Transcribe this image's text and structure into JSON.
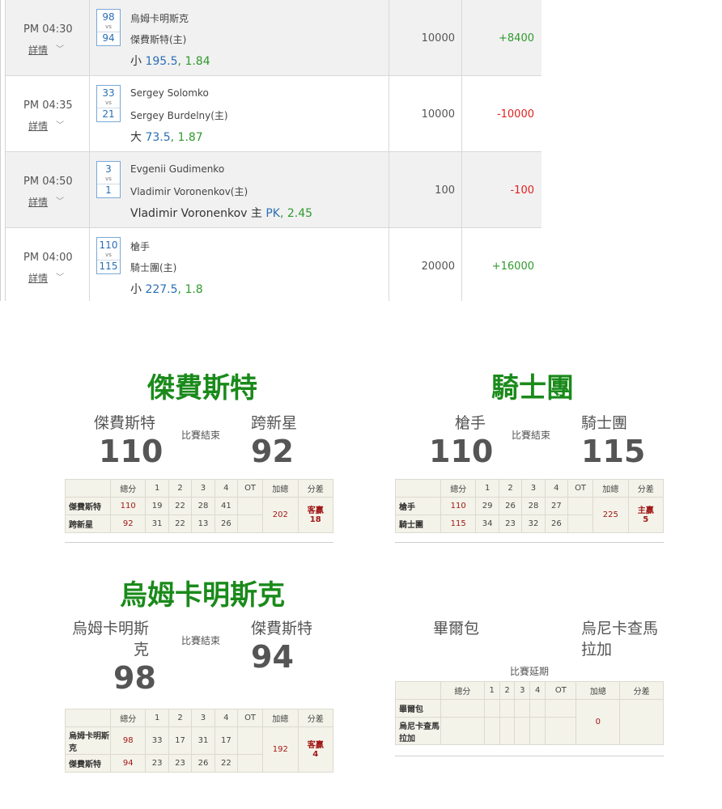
{
  "bets": [
    {
      "time": "PM 04:30",
      "detail": "詳情",
      "score1": "98",
      "score2": "94",
      "vs": "vs",
      "team1": "烏姆卡明斯克",
      "team2": "傑費斯特(主)",
      "pick_prefix": "小 ",
      "pick_line": "195.5",
      "pick_sep": ", ",
      "pick_odds": "1.84",
      "stake": "10000",
      "result": "+8400",
      "result_sign": "pos"
    },
    {
      "time": "PM 04:35",
      "detail": "詳情",
      "score1": "33",
      "score2": "21",
      "vs": "vs",
      "team1": "Sergey Solomko",
      "team2": "Sergey Burdelny(主)",
      "pick_prefix": "大 ",
      "pick_line": "73.5",
      "pick_sep": ", ",
      "pick_odds": "1.87",
      "stake": "10000",
      "result": "-10000",
      "result_sign": "neg"
    },
    {
      "time": "PM 04:50",
      "detail": "詳情",
      "score1": "3",
      "score2": "1",
      "vs": "vs",
      "team1": "Evgenii Gudimenko",
      "team2": "Vladimir Voronenkov(主)",
      "pick_prefix": "Vladimir Voronenkov 主 ",
      "pick_line": "PK",
      "pick_sep": ", ",
      "pick_odds": "2.45",
      "stake": "100",
      "result": "-100",
      "result_sign": "neg"
    },
    {
      "time": "PM 04:00",
      "detail": "詳情",
      "score1": "110",
      "score2": "115",
      "vs": "vs",
      "team1": "槍手",
      "team2": "騎士團(主)",
      "pick_prefix": "小 ",
      "pick_line": "227.5",
      "pick_sep": ", ",
      "pick_odds": "1.8",
      "stake": "20000",
      "result": "+16000",
      "result_sign": "pos"
    }
  ],
  "header_cols": [
    "總分",
    "1",
    "2",
    "3",
    "4",
    "OT",
    "加總",
    "分差"
  ],
  "cards": [
    {
      "winner": "傑費斯特",
      "home_name": "傑費斯特",
      "away_name": "跨新星",
      "status": "比賽結束",
      "home_score": "110",
      "away_score": "92",
      "rows": [
        {
          "name": "傑費斯特",
          "total": "110",
          "q": [
            "19",
            "22",
            "28",
            "41"
          ],
          "ot": ""
        },
        {
          "name": "跨新星",
          "total": "92",
          "q": [
            "31",
            "22",
            "13",
            "26"
          ],
          "ot": ""
        }
      ],
      "sum": "202",
      "diff1": "客贏",
      "diff2": "18"
    },
    {
      "winner": "騎士團",
      "home_name": "槍手",
      "away_name": "騎士團",
      "status": "比賽結束",
      "home_score": "110",
      "away_score": "115",
      "rows": [
        {
          "name": "槍手",
          "total": "110",
          "q": [
            "29",
            "26",
            "28",
            "27"
          ],
          "ot": ""
        },
        {
          "name": "騎士團",
          "total": "115",
          "q": [
            "34",
            "23",
            "32",
            "26"
          ],
          "ot": ""
        }
      ],
      "sum": "225",
      "diff1": "主贏",
      "diff2": "5"
    },
    {
      "winner": "烏姆卡明斯克",
      "home_name": "烏姆卡明斯克",
      "away_name": "傑費斯特",
      "status": "比賽結束",
      "home_score": "98",
      "away_score": "94",
      "rows": [
        {
          "name": "烏姆卡明斯克",
          "total": "98",
          "q": [
            "33",
            "17",
            "31",
            "17"
          ],
          "ot": ""
        },
        {
          "name": "傑費斯特",
          "total": "94",
          "q": [
            "23",
            "23",
            "26",
            "22"
          ],
          "ot": ""
        }
      ],
      "sum": "192",
      "diff1": "客贏",
      "diff2": "4"
    },
    {
      "winner": "",
      "home_name": "畢爾包",
      "away_name": "烏尼卡查馬拉加",
      "status": "比賽延期",
      "home_score": "",
      "away_score": "",
      "rows": [
        {
          "name": "畢爾包",
          "total": "",
          "q": [
            "",
            "",
            "",
            ""
          ],
          "ot": ""
        },
        {
          "name": "烏尼卡查馬拉加",
          "total": "",
          "q": [
            "",
            "",
            "",
            ""
          ],
          "ot": ""
        }
      ],
      "sum": "0",
      "diff1": "",
      "diff2": ""
    }
  ]
}
